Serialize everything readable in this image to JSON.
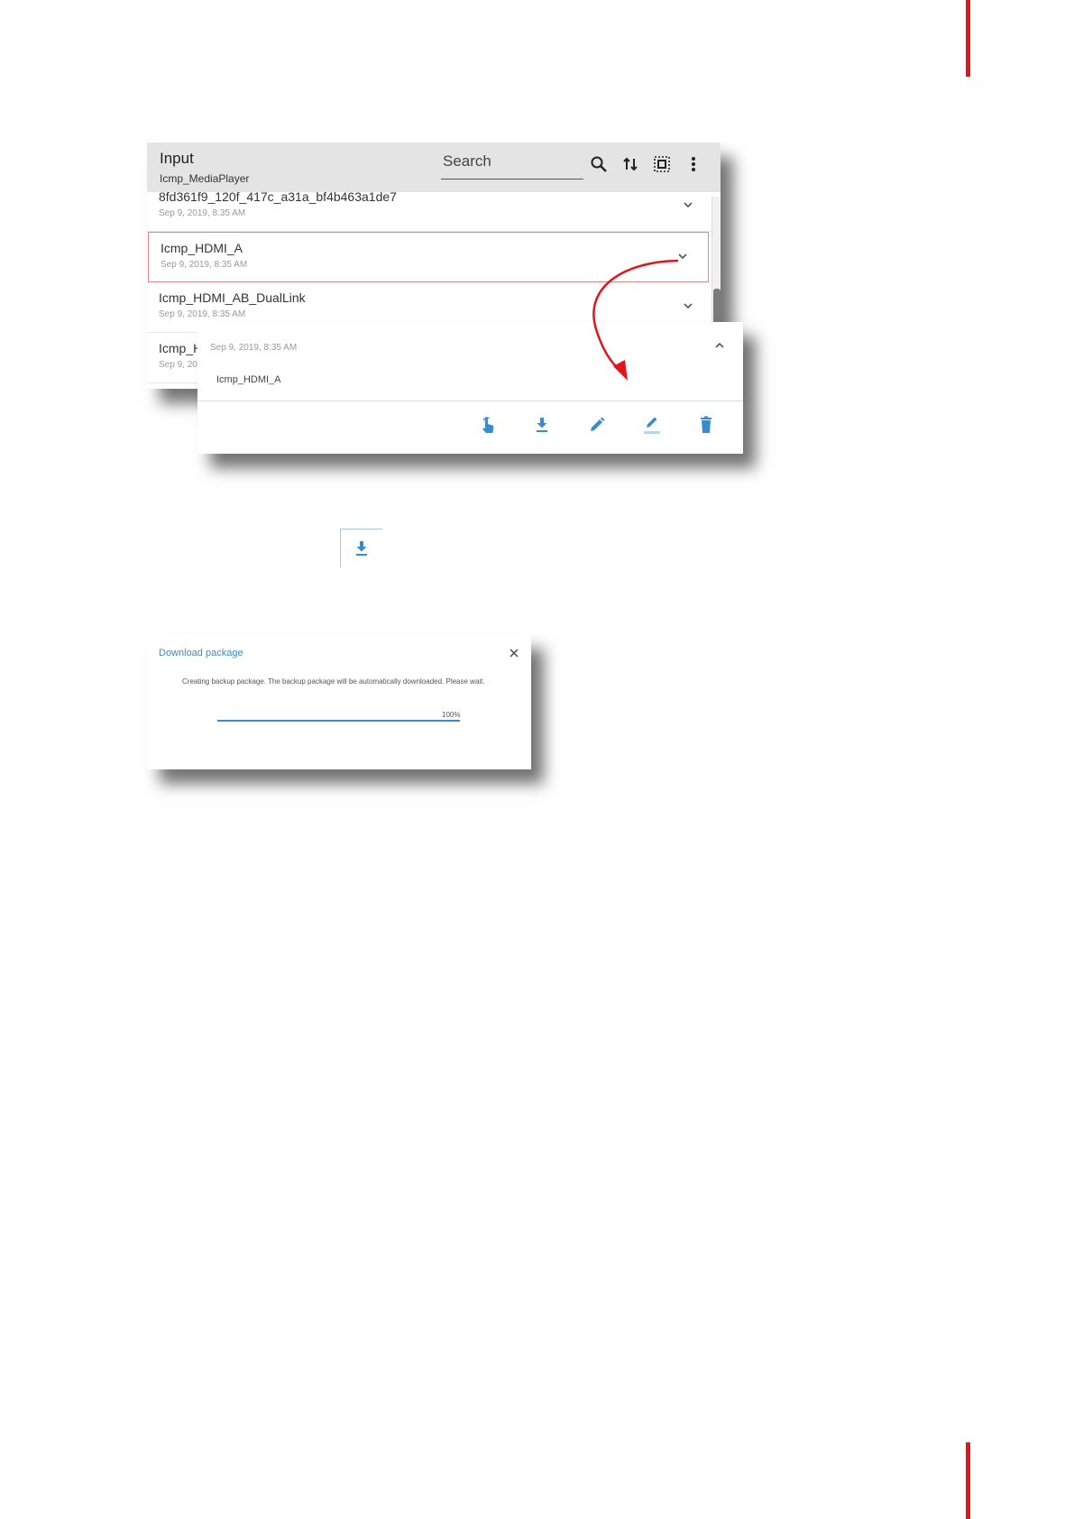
{
  "accent_color": "#3a8cc9",
  "brand_color": "#e3141c",
  "panel": {
    "title": "Input",
    "subtitle": "Icmp_MediaPlayer",
    "search_placeholder": "Search",
    "toolbar_icons": [
      "search-icon",
      "sort-icon",
      "select-all-icon",
      "more-vert-icon"
    ],
    "rows": [
      {
        "name": "8fd361f9_120f_417c_a31a_bf4b463a1de7",
        "date": "Sep 9, 2019, 8:35 AM"
      },
      {
        "name": "Icmp_HDMI_A",
        "date": "Sep 9, 2019, 8:35 AM",
        "selected": true
      },
      {
        "name": "Icmp_HDMI_AB_DualLink",
        "date": "Sep 9, 2019, 8:35 AM"
      },
      {
        "name": "Icmp_H",
        "date": "Sep 9, 20"
      }
    ]
  },
  "card": {
    "date": "Sep 9, 2019, 8:35 AM",
    "name": "Icmp_HDMI_A",
    "actions": [
      "touch-icon",
      "download-icon",
      "edit-icon",
      "rename-icon",
      "delete-icon"
    ]
  },
  "download_button_icon": "download-icon",
  "dialog": {
    "title": "Download package",
    "message": "Creating backup package. The backup package will be automatically downloaded. Please wait.",
    "progress_label": "100%",
    "progress_value": 1.0
  }
}
